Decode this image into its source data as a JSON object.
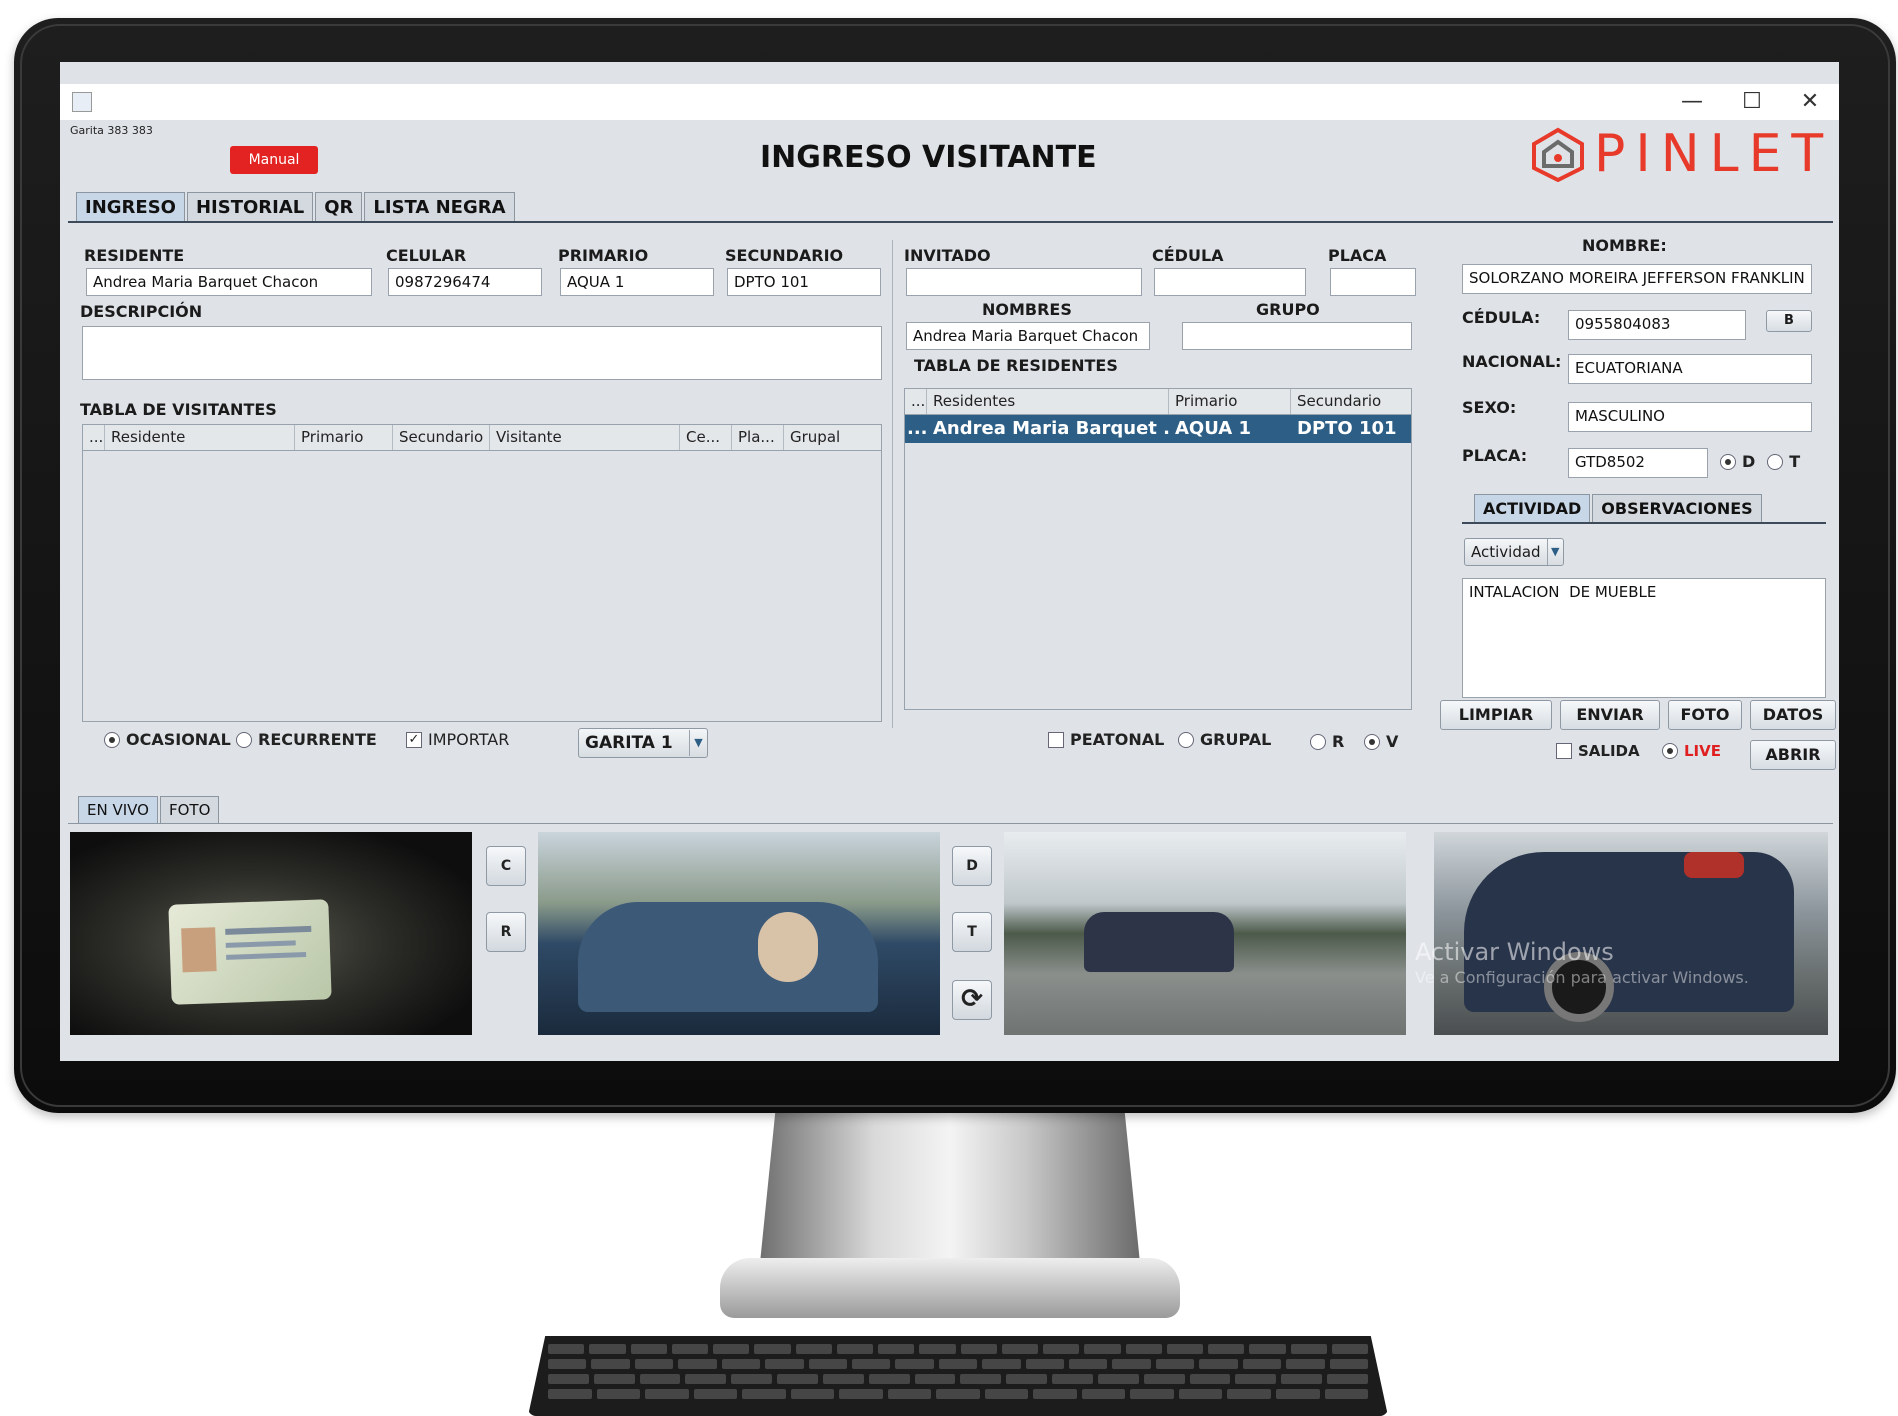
{
  "window": {
    "status_text": "Garita  383  383",
    "controls": {
      "minimize": "—",
      "maximize": "☐",
      "close": "✕"
    }
  },
  "header": {
    "manual_label": "Manual",
    "title": "INGRESO VISITANTE",
    "logo_text": "PINLET"
  },
  "tabs": [
    {
      "label": "INGRESO",
      "active": true
    },
    {
      "label": "HISTORIAL",
      "active": false
    },
    {
      "label": "QR",
      "active": false
    },
    {
      "label": "LISTA NEGRA",
      "active": false
    }
  ],
  "resident": {
    "residente_label": "RESIDENTE",
    "residente_value": "Andrea Maria Barquet Chacon",
    "celular_label": "CELULAR",
    "celular_value": "0987296474",
    "primario_label": "PRIMARIO",
    "primario_value": "AQUA 1",
    "secundario_label": "SECUNDARIO",
    "secundario_value": "DPTO 101",
    "descripcion_label": "DESCRIPCIÓN",
    "descripcion_value": ""
  },
  "visitors_table": {
    "title": "TABLA DE VISITANTES",
    "columns": [
      "...",
      "Residente",
      "Primario",
      "Secundario",
      "Visitante",
      "Ce...",
      "Pla...",
      "Grupal"
    ],
    "rows": []
  },
  "guest": {
    "invitado_label": "INVITADO",
    "invitado_value": "",
    "cedula_label": "CÉDULA",
    "cedula_value": "",
    "placa_label": "PLACA",
    "placa_value": "",
    "nombres_label": "NOMBRES",
    "nombres_value": "Andrea Maria Barquet Chacon",
    "grupo_label": "GRUPO",
    "grupo_value": ""
  },
  "residents_table": {
    "title": "TABLA DE RESIDENTES",
    "columns": [
      "...",
      "Residentes",
      "Primario",
      "Secundario"
    ],
    "rows": [
      {
        "marker": "...",
        "residente": "Andrea Maria Barquet ...",
        "primario": "AQUA 1",
        "secundario": "DPTO 101"
      }
    ]
  },
  "visitor": {
    "nombre_label": "NOMBRE:",
    "nombre_value": "SOLORZANO MOREIRA JEFFERSON FRANKLIN",
    "cedula_label": "CÉDULA:",
    "cedula_value": "0955804083",
    "b_button": "B",
    "nacional_label": "NACIONAL:",
    "nacional_value": "ECUATORIANA",
    "sexo_label": "SEXO:",
    "sexo_value": "MASCULINO",
    "placa_label": "PLACA:",
    "placa_value": "GTD8502",
    "placa_options": [
      {
        "label": "D",
        "selected": true
      },
      {
        "label": "T",
        "selected": false
      }
    ]
  },
  "activity": {
    "tabs": [
      {
        "label": "ACTIVIDAD",
        "active": true
      },
      {
        "label": "OBSERVACIONES",
        "active": false
      }
    ],
    "select_value": "Actividad",
    "text": "INTALACION  DE MUEBLE"
  },
  "actions": {
    "limpiar": "LIMPIAR",
    "enviar": "ENVIAR",
    "foto": "FOTO",
    "datos": "DATOS",
    "salida_label": "SALIDA",
    "live_label": "LIVE",
    "abrir": "ABRIR"
  },
  "options_left": {
    "ocasional": "OCASIONAL",
    "recurrente": "RECURRENTE",
    "importar": "IMPORTAR",
    "garita_value": "GARITA 1"
  },
  "options_mid": {
    "peatonal": "PEATONAL",
    "grupal": "GRUPAL",
    "r": "R",
    "v": "V"
  },
  "camera_tabs": [
    {
      "label": "EN VIVO",
      "active": true
    },
    {
      "label": "FOTO",
      "active": false
    }
  ],
  "camera_buttons": {
    "c": "C",
    "r": "R",
    "d": "D",
    "t": "T",
    "refresh_icon": "refresh-icon"
  },
  "watermark": {
    "line1": "Activar Windows",
    "line2": "Ve a Configuración para activar Windows."
  },
  "colors": {
    "accent_blue": "#2d5e86",
    "manual_red": "#e32222",
    "logo_red": "#e83a2a",
    "live_red": "#e02020"
  }
}
